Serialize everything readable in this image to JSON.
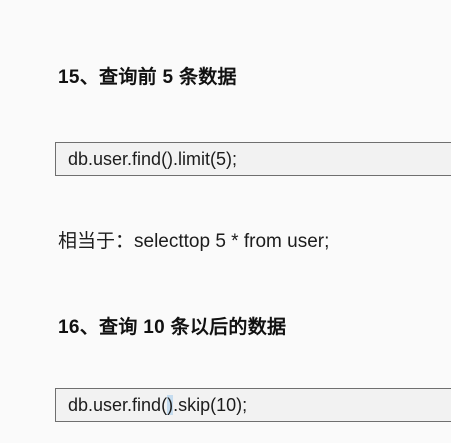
{
  "section15": {
    "heading": "15、查询前 5 条数据",
    "code": "db.user.find().limit(5);",
    "equivalent": "相当于：selecttop 5 * from user;"
  },
  "section16": {
    "heading": "16、查询 10 条以后的数据",
    "code_prefix": "db.user.find(",
    "code_selected": ")",
    "code_suffix": ".skip(10);"
  },
  "colors": {
    "selection_highlight": "#c5dcef",
    "code_background": "#f2f2f2",
    "code_border": "#6f6f6f"
  }
}
